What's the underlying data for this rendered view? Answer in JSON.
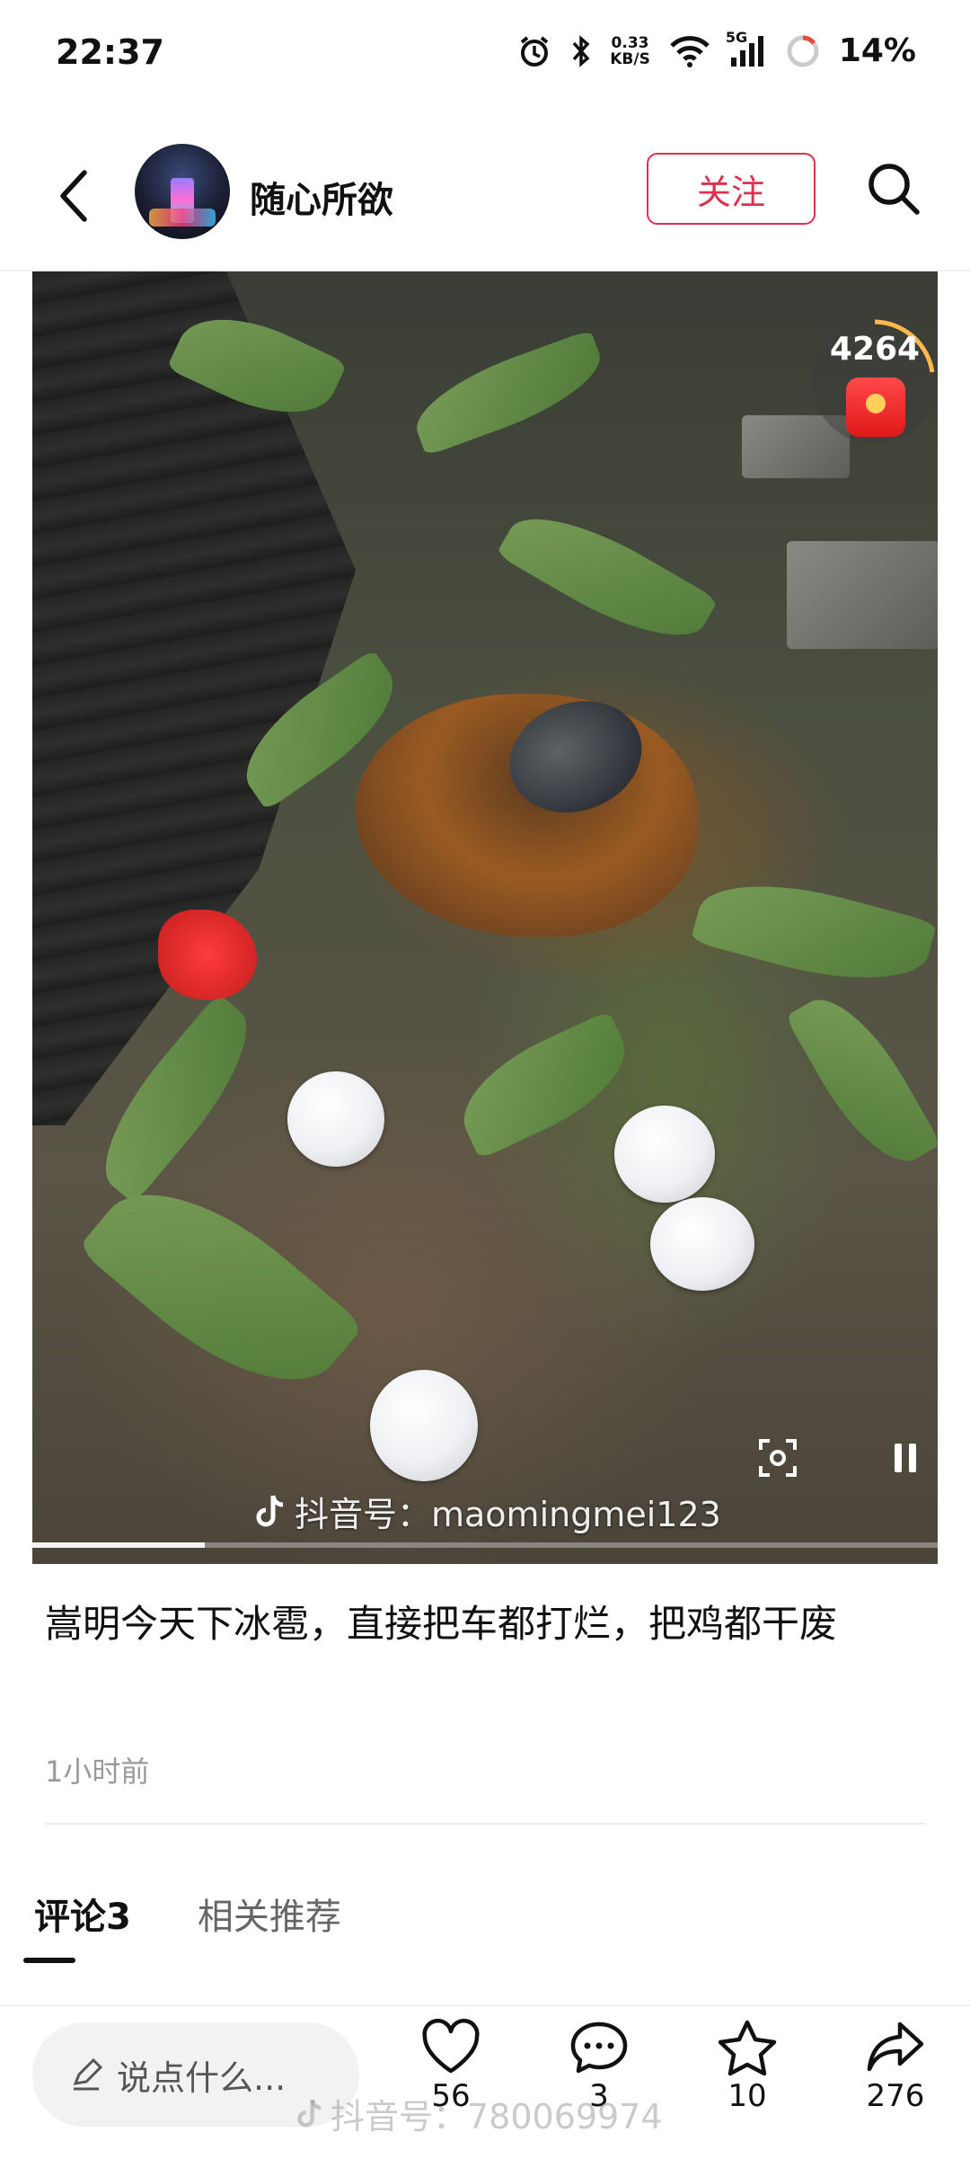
{
  "status_bar": {
    "time": "22:37",
    "net_speed_value": "0.33",
    "net_speed_unit": "KB/S",
    "network": "5G",
    "battery_percent": "14%",
    "icons": [
      "alarm-icon",
      "bluetooth-icon",
      "wifi-icon",
      "signal-icon",
      "battery-ring-icon"
    ]
  },
  "header": {
    "username": "随心所欲",
    "follow_label": "关注",
    "icons": [
      "back-icon",
      "search-icon"
    ]
  },
  "video": {
    "red_packet_count": "4264",
    "watermark": "抖音号：maomingmei123",
    "progress": 0.19,
    "icons": [
      "red-packet-icon",
      "screenshot-scan-icon",
      "pause-icon",
      "tiktok-logo-icon"
    ]
  },
  "post": {
    "title": "嵩明今天下冰雹，直接把车都打烂，把鸡都干废",
    "time_ago": "1小时前"
  },
  "tabs": [
    {
      "label": "评论3",
      "active": true
    },
    {
      "label": "相关推荐",
      "active": false
    }
  ],
  "bottom_bar": {
    "input_placeholder": "说点什么...",
    "likes": "56",
    "comments": "3",
    "favorites": "10",
    "shares": "276",
    "overlay_watermark": "抖音号：780069974",
    "icons": [
      "edit-icon",
      "heart-icon",
      "comment-icon",
      "star-icon",
      "share-icon"
    ]
  },
  "colors": {
    "accent": "#e0304e",
    "text": "#111111",
    "muted": "#9a9a9a"
  }
}
